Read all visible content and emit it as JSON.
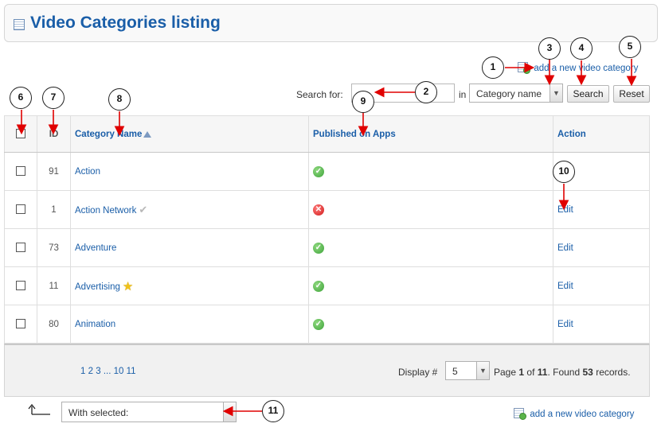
{
  "header": {
    "title": "Video Categories listing"
  },
  "add_link_top": "add a new video category",
  "add_link_bottom": "add a new video category",
  "search": {
    "label": "Search for:",
    "value": "",
    "in_label": "in",
    "field_selected": "Category name",
    "search_button": "Search",
    "reset_button": "Reset"
  },
  "table": {
    "headers": {
      "id": "ID",
      "name": "Category Name",
      "published": "Published on Apps",
      "action": "Action"
    },
    "rows": [
      {
        "id": "91",
        "name": "Action",
        "published": true,
        "badge": "",
        "action": ""
      },
      {
        "id": "1",
        "name": "Action Network",
        "published": false,
        "badge": "check",
        "action": "Edit"
      },
      {
        "id": "73",
        "name": "Adventure",
        "published": true,
        "badge": "",
        "action": "Edit"
      },
      {
        "id": "11",
        "name": "Advertising",
        "published": true,
        "badge": "star",
        "action": "Edit"
      },
      {
        "id": "80",
        "name": "Animation",
        "published": true,
        "badge": "",
        "action": "Edit"
      }
    ]
  },
  "footer": {
    "pages": [
      "1",
      "2",
      "3",
      "...",
      "10",
      "11"
    ],
    "display_label": "Display #",
    "display_value": "5",
    "page_text": "Page",
    "page_current": "1",
    "page_of": "of",
    "page_total": "11",
    "found_text": ". Found",
    "found_count": "53",
    "records_text": "records."
  },
  "bulk": {
    "selected": "With selected:"
  },
  "callouts": [
    "1",
    "2",
    "3",
    "4",
    "5",
    "6",
    "7",
    "8",
    "9",
    "10",
    "11"
  ],
  "colors": {
    "link": "#1a5ea8",
    "arrow": "#e00000",
    "header_bg": "#f9f9f9"
  },
  "icons": {
    "published_true": "green-check-icon",
    "published_false": "red-x-icon",
    "badge_check": "grey-check-icon",
    "badge_star": "star-icon"
  }
}
